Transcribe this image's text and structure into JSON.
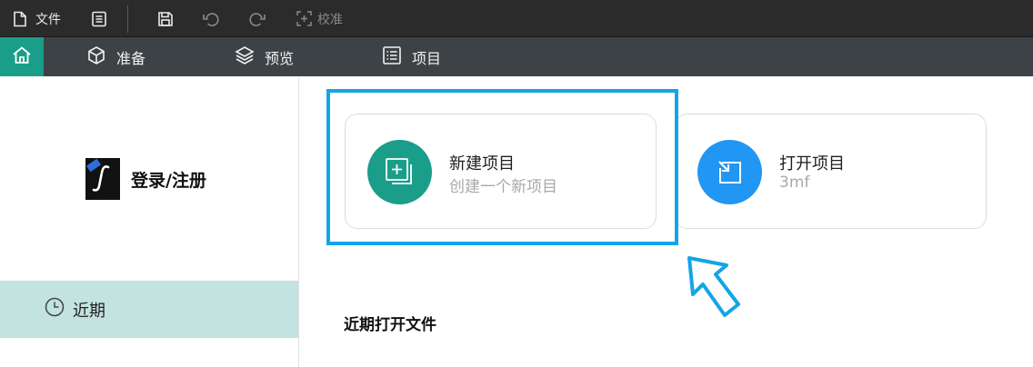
{
  "toolbar": {
    "file_label": "文件",
    "calibrate_label": "校准"
  },
  "nav": {
    "tabs": [
      {
        "label": "准备",
        "icon": "cube-icon"
      },
      {
        "label": "预览",
        "icon": "layers-icon"
      },
      {
        "label": "项目",
        "icon": "list-icon"
      }
    ]
  },
  "sidebar": {
    "login_label": "登录/注册",
    "recent_label": "近期"
  },
  "main": {
    "new_project": {
      "title": "新建项目",
      "subtitle": "创建一个新项目"
    },
    "open_project": {
      "title": "打开项目",
      "subtitle": "3mf"
    },
    "recent_files_title": "近期打开文件"
  },
  "colors": {
    "accent": "#1a9e8a",
    "open_blue": "#2196f3",
    "highlight": "#14a5e6",
    "sidebar_selected": "#c2e3df"
  }
}
